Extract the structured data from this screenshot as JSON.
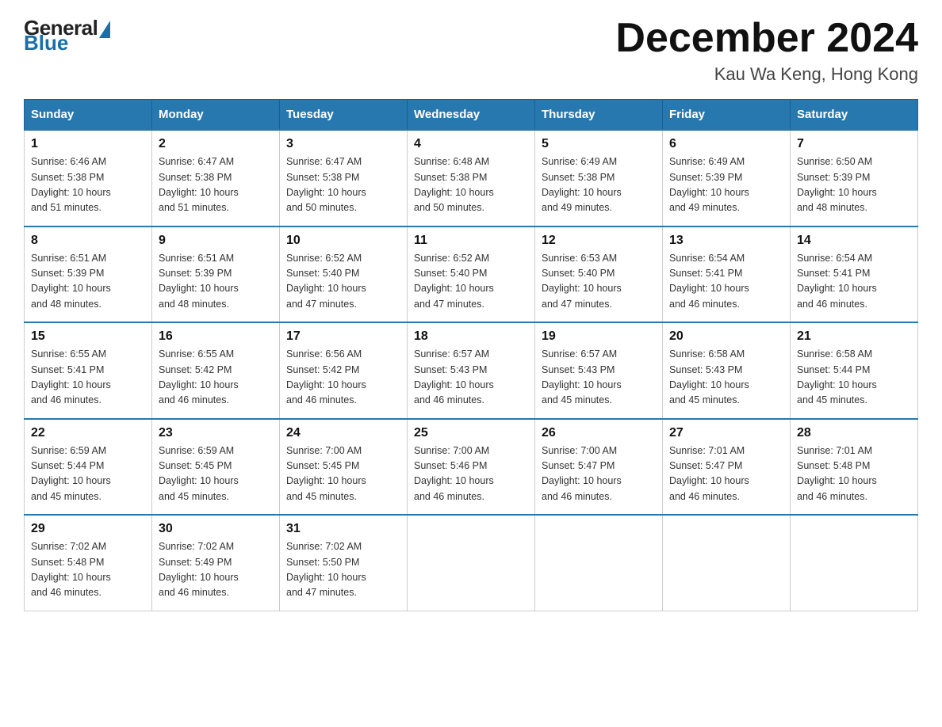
{
  "header": {
    "logo_general": "General",
    "logo_blue": "Blue",
    "month_year": "December 2024",
    "location": "Kau Wa Keng, Hong Kong"
  },
  "days_of_week": [
    "Sunday",
    "Monday",
    "Tuesday",
    "Wednesday",
    "Thursday",
    "Friday",
    "Saturday"
  ],
  "weeks": [
    [
      {
        "day": "1",
        "sunrise": "6:46 AM",
        "sunset": "5:38 PM",
        "daylight": "10 hours and 51 minutes."
      },
      {
        "day": "2",
        "sunrise": "6:47 AM",
        "sunset": "5:38 PM",
        "daylight": "10 hours and 51 minutes."
      },
      {
        "day": "3",
        "sunrise": "6:47 AM",
        "sunset": "5:38 PM",
        "daylight": "10 hours and 50 minutes."
      },
      {
        "day": "4",
        "sunrise": "6:48 AM",
        "sunset": "5:38 PM",
        "daylight": "10 hours and 50 minutes."
      },
      {
        "day": "5",
        "sunrise": "6:49 AM",
        "sunset": "5:38 PM",
        "daylight": "10 hours and 49 minutes."
      },
      {
        "day": "6",
        "sunrise": "6:49 AM",
        "sunset": "5:39 PM",
        "daylight": "10 hours and 49 minutes."
      },
      {
        "day": "7",
        "sunrise": "6:50 AM",
        "sunset": "5:39 PM",
        "daylight": "10 hours and 48 minutes."
      }
    ],
    [
      {
        "day": "8",
        "sunrise": "6:51 AM",
        "sunset": "5:39 PM",
        "daylight": "10 hours and 48 minutes."
      },
      {
        "day": "9",
        "sunrise": "6:51 AM",
        "sunset": "5:39 PM",
        "daylight": "10 hours and 48 minutes."
      },
      {
        "day": "10",
        "sunrise": "6:52 AM",
        "sunset": "5:40 PM",
        "daylight": "10 hours and 47 minutes."
      },
      {
        "day": "11",
        "sunrise": "6:52 AM",
        "sunset": "5:40 PM",
        "daylight": "10 hours and 47 minutes."
      },
      {
        "day": "12",
        "sunrise": "6:53 AM",
        "sunset": "5:40 PM",
        "daylight": "10 hours and 47 minutes."
      },
      {
        "day": "13",
        "sunrise": "6:54 AM",
        "sunset": "5:41 PM",
        "daylight": "10 hours and 46 minutes."
      },
      {
        "day": "14",
        "sunrise": "6:54 AM",
        "sunset": "5:41 PM",
        "daylight": "10 hours and 46 minutes."
      }
    ],
    [
      {
        "day": "15",
        "sunrise": "6:55 AM",
        "sunset": "5:41 PM",
        "daylight": "10 hours and 46 minutes."
      },
      {
        "day": "16",
        "sunrise": "6:55 AM",
        "sunset": "5:42 PM",
        "daylight": "10 hours and 46 minutes."
      },
      {
        "day": "17",
        "sunrise": "6:56 AM",
        "sunset": "5:42 PM",
        "daylight": "10 hours and 46 minutes."
      },
      {
        "day": "18",
        "sunrise": "6:57 AM",
        "sunset": "5:43 PM",
        "daylight": "10 hours and 46 minutes."
      },
      {
        "day": "19",
        "sunrise": "6:57 AM",
        "sunset": "5:43 PM",
        "daylight": "10 hours and 45 minutes."
      },
      {
        "day": "20",
        "sunrise": "6:58 AM",
        "sunset": "5:43 PM",
        "daylight": "10 hours and 45 minutes."
      },
      {
        "day": "21",
        "sunrise": "6:58 AM",
        "sunset": "5:44 PM",
        "daylight": "10 hours and 45 minutes."
      }
    ],
    [
      {
        "day": "22",
        "sunrise": "6:59 AM",
        "sunset": "5:44 PM",
        "daylight": "10 hours and 45 minutes."
      },
      {
        "day": "23",
        "sunrise": "6:59 AM",
        "sunset": "5:45 PM",
        "daylight": "10 hours and 45 minutes."
      },
      {
        "day": "24",
        "sunrise": "7:00 AM",
        "sunset": "5:45 PM",
        "daylight": "10 hours and 45 minutes."
      },
      {
        "day": "25",
        "sunrise": "7:00 AM",
        "sunset": "5:46 PM",
        "daylight": "10 hours and 46 minutes."
      },
      {
        "day": "26",
        "sunrise": "7:00 AM",
        "sunset": "5:47 PM",
        "daylight": "10 hours and 46 minutes."
      },
      {
        "day": "27",
        "sunrise": "7:01 AM",
        "sunset": "5:47 PM",
        "daylight": "10 hours and 46 minutes."
      },
      {
        "day": "28",
        "sunrise": "7:01 AM",
        "sunset": "5:48 PM",
        "daylight": "10 hours and 46 minutes."
      }
    ],
    [
      {
        "day": "29",
        "sunrise": "7:02 AM",
        "sunset": "5:48 PM",
        "daylight": "10 hours and 46 minutes."
      },
      {
        "day": "30",
        "sunrise": "7:02 AM",
        "sunset": "5:49 PM",
        "daylight": "10 hours and 46 minutes."
      },
      {
        "day": "31",
        "sunrise": "7:02 AM",
        "sunset": "5:50 PM",
        "daylight": "10 hours and 47 minutes."
      },
      null,
      null,
      null,
      null
    ]
  ],
  "labels": {
    "sunrise_prefix": "Sunrise: ",
    "sunset_prefix": "Sunset: ",
    "daylight_prefix": "Daylight: "
  }
}
